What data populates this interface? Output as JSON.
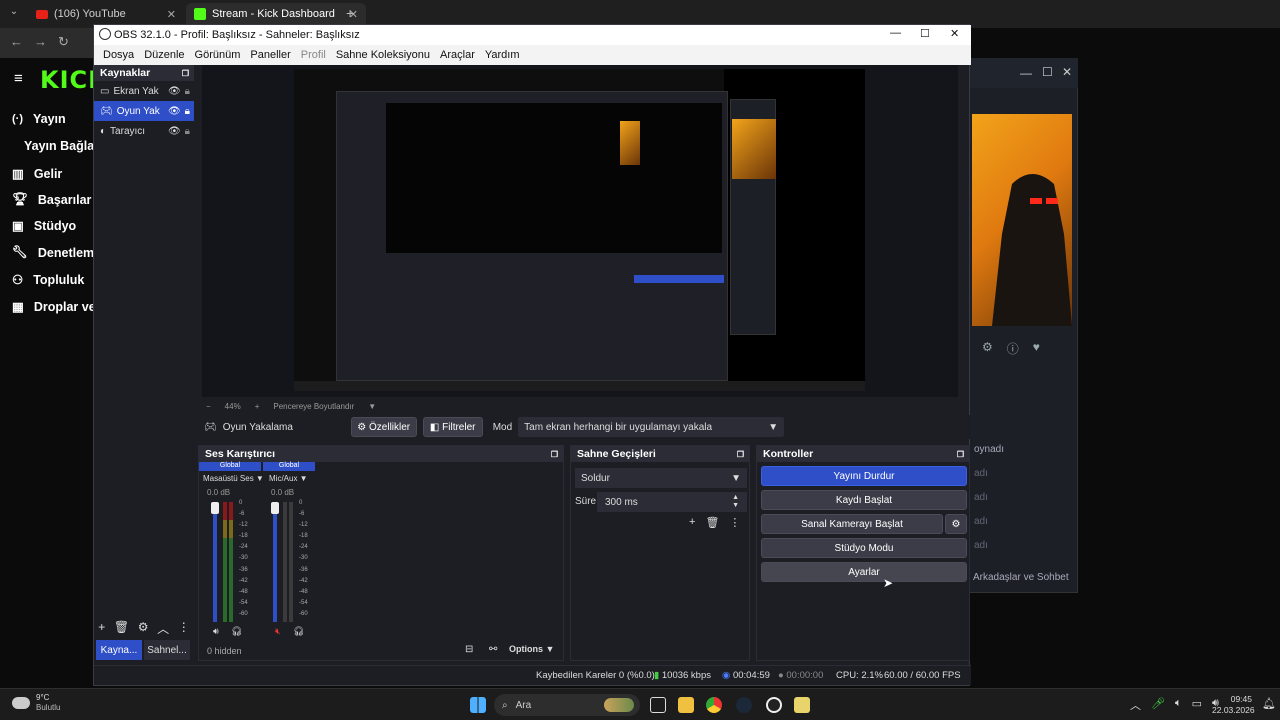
{
  "browser": {
    "tabs": [
      {
        "label": "(106) YouTube",
        "icon": "youtube-icon"
      },
      {
        "label": "Stream - Kick Dashboard",
        "icon": "kick-icon"
      }
    ],
    "new_tab_icon": "plus-icon"
  },
  "kick": {
    "logo": "KICK",
    "nav": [
      {
        "label": "Yayın",
        "icon": "broadcast-icon"
      },
      {
        "label": "Yayın Bağlant",
        "icon": ""
      },
      {
        "label": "Gelir",
        "icon": "chart-icon"
      },
      {
        "label": "Başarılar",
        "icon": "trophy-icon"
      },
      {
        "label": "Stüdyo",
        "icon": "studio-icon"
      },
      {
        "label": "Denetleme",
        "icon": "wrench-icon"
      },
      {
        "label": "Topluluk",
        "icon": "community-icon"
      },
      {
        "label": "Droplar ve ö",
        "icon": "gift-icon"
      }
    ]
  },
  "obs": {
    "title": "OBS 32.1.0 - Profil: Başlıksız - Sahneler: Başlıksız",
    "menu": [
      "Dosya",
      "Düzenle",
      "Görünüm",
      "Paneller",
      "Profil",
      "Sahne Koleksiyonu",
      "Araçlar",
      "Yardım"
    ],
    "sources_header": "Kaynaklar",
    "sources": [
      {
        "label": "Ekran Yak",
        "icon": "monitor-icon"
      },
      {
        "label": "Oyun Yak",
        "icon": "gamepad-icon"
      },
      {
        "label": "Tarayıcı",
        "icon": "globe-icon"
      }
    ],
    "bottom_tabs": [
      "Kayna...",
      "Sahnel..."
    ],
    "zoom": {
      "minus": "−",
      "value": "44%",
      "plus": "+",
      "fit": "Pencereye Boyutlandır"
    },
    "source_toolbar": {
      "name": "Oyun Yakalama",
      "properties": "Özellikler",
      "filters": "Filtreler",
      "mode_label": "Mod",
      "mode_value": "Tam ekran herhangi bir uygulamayı yakala"
    },
    "mixer": {
      "header": "Ses Karıştırıcı",
      "channels": [
        {
          "global": "Global",
          "name": "Masaüstü Ses",
          "db": "0.0 dB"
        },
        {
          "global": "Global",
          "name": "Mic/Aux",
          "db": "0.0 dB"
        }
      ],
      "scale": [
        "0",
        "-6",
        "-12",
        "-18",
        "-24",
        "-30",
        "-36",
        "-42",
        "-48",
        "-54",
        "-60"
      ],
      "hidden": "0 hidden",
      "options": "Options"
    },
    "transitions": {
      "header": "Sahne Geçişleri",
      "type": "Soldur",
      "duration_label": "Süre",
      "duration_value": "300 ms"
    },
    "controls": {
      "header": "Kontroller",
      "buttons": [
        "Yayını Durdur",
        "Kaydı Başlat",
        "Sanal Kamerayı Başlat",
        "Stüdyo Modu",
        "Ayarlar"
      ]
    },
    "status": {
      "dropped": "Kaybedilen Kareler 0 (%0.0)",
      "bitrate": "10036 kbps",
      "stream_time": "00:04:59",
      "rec_time": "00:00:00",
      "cpu": "CPU: 2.1%",
      "fps": "60.00 / 60.00 FPS"
    }
  },
  "bg_window": {
    "items": [
      "oynadı",
      "adı",
      "adı",
      "adı",
      "adı"
    ],
    "friends": "Arkadaşlar ve Sohbet"
  },
  "taskbar": {
    "weather_temp": "9°C",
    "weather_desc": "Bulutlu",
    "search": "Ara",
    "time": "09:45",
    "date": "22.03.2026"
  }
}
